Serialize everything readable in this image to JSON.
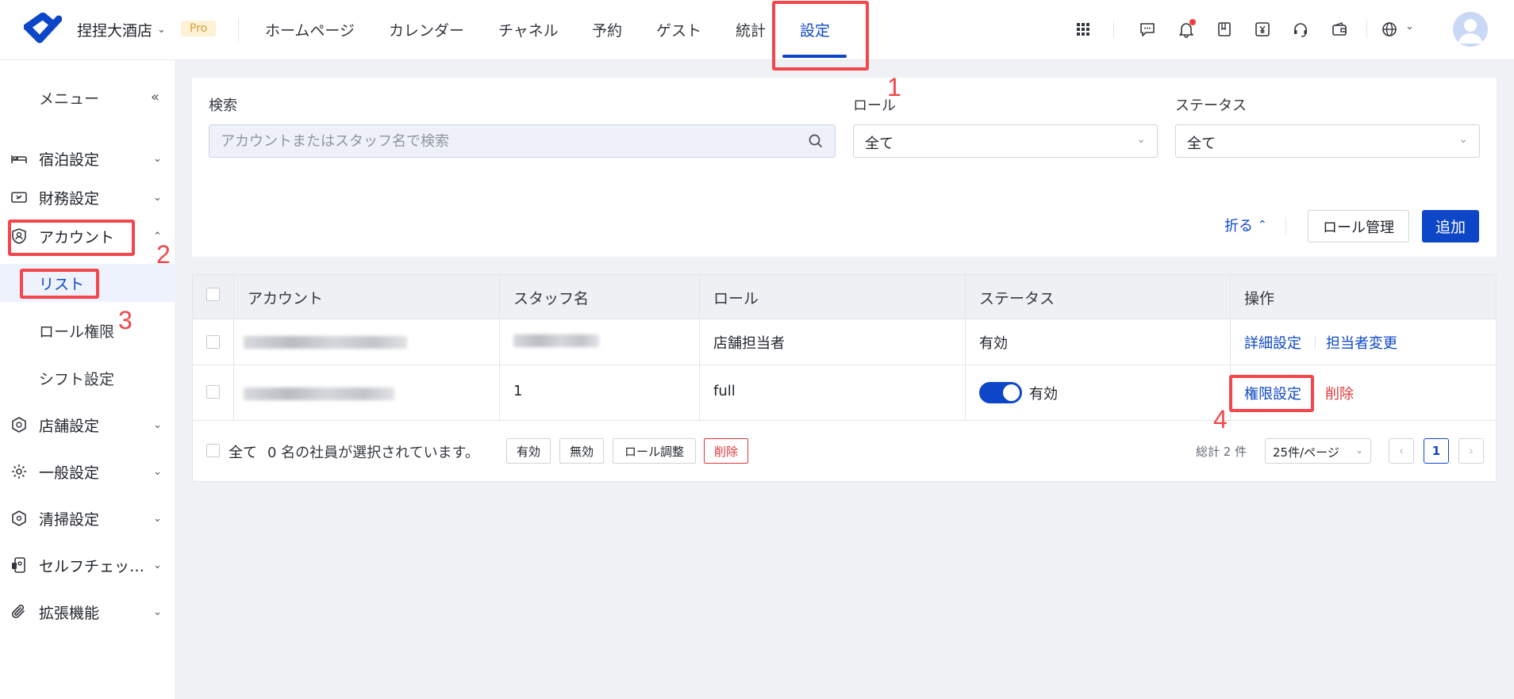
{
  "header": {
    "hotel_name": "捏捏大酒店",
    "badge": "Pro",
    "nav": [
      {
        "label": "ホームページ"
      },
      {
        "label": "カレンダー"
      },
      {
        "label": "チャネル"
      },
      {
        "label": "予約"
      },
      {
        "label": "ゲスト"
      },
      {
        "label": "統計"
      },
      {
        "label": "設定",
        "active": true
      }
    ],
    "icons": [
      "apps-grid-icon",
      "message-icon",
      "bell-icon",
      "book-icon",
      "yen-receipt-icon",
      "headset-icon",
      "wallet-icon",
      "globe-icon"
    ]
  },
  "sidebar": {
    "menu_title": "メニュー",
    "items": [
      {
        "label": "宿泊設定",
        "icon": "bed-icon"
      },
      {
        "label": "財務設定",
        "icon": "cash-register-icon"
      },
      {
        "label": "アカウント",
        "icon": "user-shield-icon",
        "expanded": true
      },
      {
        "label": "店舗設定",
        "icon": "store-icon"
      },
      {
        "label": "一般設定",
        "icon": "gear-icon"
      },
      {
        "label": "清掃設定",
        "icon": "cleaning-icon"
      },
      {
        "label": "セルフチェック...",
        "icon": "kiosk-icon"
      },
      {
        "label": "拡張機能",
        "icon": "paperclip-icon"
      }
    ],
    "sub_items": [
      {
        "label": "リスト",
        "active": true
      },
      {
        "label": "ロール権限"
      },
      {
        "label": "シフト設定"
      }
    ]
  },
  "filters": {
    "search_label": "検索",
    "search_placeholder": "アカウントまたはスタッフ名で検索",
    "role_label": "ロール",
    "role_value": "全て",
    "status_label": "ステータス",
    "status_value": "全て",
    "fold_label": "折る",
    "role_manage_button": "ロール管理",
    "add_button": "追加"
  },
  "table": {
    "columns": [
      "アカウント",
      "スタッフ名",
      "ロール",
      "ステータス",
      "操作"
    ],
    "rows": [
      {
        "account": "",
        "staff": "",
        "role": "店舗担当者",
        "status": "有効",
        "actions": [
          "詳細設定",
          "担当者変更"
        ]
      },
      {
        "account": "",
        "staff": "1",
        "role": "full",
        "status": "有効",
        "status_toggle": true,
        "actions": [
          "権限設定",
          "削除"
        ]
      }
    ],
    "footer": {
      "select_all": "全て",
      "selected_text": "0 名の社員が選択されています。",
      "bulk_enable": "有効",
      "bulk_disable": "無効",
      "bulk_role": "ロール調整",
      "bulk_delete": "削除",
      "total": "総計 2 件",
      "page_size": "25件/ページ",
      "current_page": "1"
    }
  },
  "annotations": [
    "1",
    "2",
    "3",
    "4"
  ],
  "colors": {
    "accent": "#0d47c8",
    "danger": "#e0373b",
    "annotation": "#f2474c"
  }
}
